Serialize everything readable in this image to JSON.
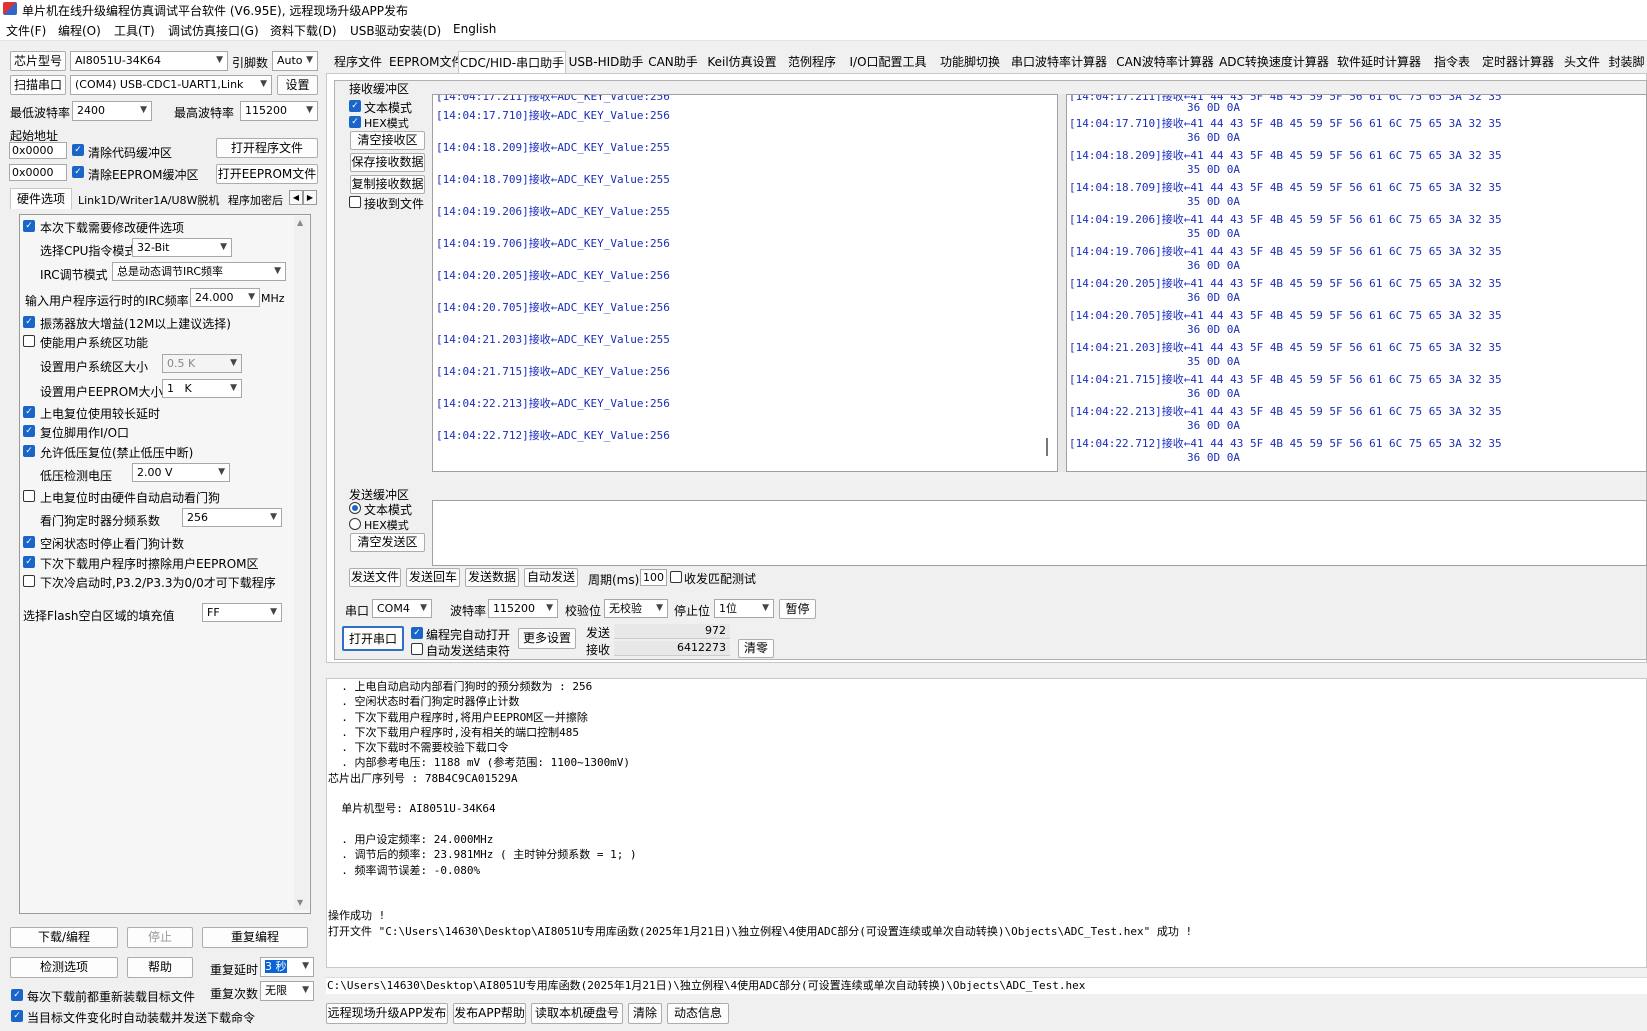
{
  "window": {
    "title": "单片机在线升级编程仿真调试平台软件 (V6.95E), 远程现场升级APP发布"
  },
  "menu": [
    "文件(F)",
    "编程(O)",
    "工具(T)",
    "调试仿真接口(G)",
    "资料下载(D)",
    "USB驱动安装(D)",
    "English"
  ],
  "left": {
    "chip_label": "芯片型号",
    "chip_value": "AI8051U-34K64",
    "pins_label": "引脚数",
    "pins_value": "Auto",
    "scan_label": "扫描串口",
    "port_value": "(COM4) USB-CDC1-UART1,Link",
    "settings_label": "设置",
    "min_baud_label": "最低波特率",
    "min_baud_value": "2400",
    "max_baud_label": "最高波特率",
    "max_baud_value": "115200",
    "start_addr_label": "起始地址",
    "addr1": "0x0000",
    "addr2": "0x0000",
    "clear_code": "清除代码缓冲区",
    "clear_eeprom": "清除EEPROM缓冲区",
    "open_prog": "打开程序文件",
    "open_eeprom": "打开EEPROM文件",
    "subtabs": [
      "硬件选项",
      "Link1D/Writer1A/U8W脱机",
      "程序加密后"
    ],
    "opts": {
      "o1": "本次下载需要修改硬件选项",
      "cpu_label": "选择CPU指令模式",
      "cpu_value": "32-Bit",
      "irc_label": "IRC调节模式",
      "irc_value": "总是动态调节IRC频率",
      "freq_label": "输入用户程序运行时的IRC频率",
      "freq_value": "24.000",
      "freq_unit": "MHz",
      "o2": "振荡器放大增益(12M以上建议选择)",
      "o3": "使能用户系统区功能",
      "sys_label": "设置用户系统区大小",
      "sys_value": "0.5 K",
      "ee_label": "设置用户EEPROM大小",
      "ee_value": "1   K",
      "o4": "上电复位使用较长延时",
      "o5": "复位脚用作I/O口",
      "o6": "允许低压复位(禁止低压中断)",
      "lv_label": "低压检测电压",
      "lv_value": "2.00 V",
      "o7": "上电复位时由硬件自动启动看门狗",
      "wdt_label": "看门狗定时器分频系数",
      "wdt_value": "256",
      "o8": "空闲状态时停止看门狗计数",
      "o9": "下次下载用户程序时擦除用户EEPROM区",
      "o10": "下次冷启动时,P3.2/P3.3为0/0才可下载程序",
      "fill_label": "选择Flash空白区域的填充值",
      "fill_value": "FF"
    },
    "btn_download": "下载/编程",
    "btn_stop": "停止",
    "btn_reprog": "重复编程",
    "btn_check": "检测选项",
    "btn_help": "帮助",
    "delay_label": "重复延时",
    "delay_value": "3 秒",
    "count_label": "重复次数",
    "count_value": "无限",
    "reload": "每次下载前都重新装载目标文件",
    "autoload": "当目标文件变化时自动装载并发送下载命令"
  },
  "tabs": [
    "程序文件",
    "EEPROM文件",
    "CDC/HID-串口助手",
    "USB-HID助手",
    "CAN助手",
    "Keil仿真设置",
    "范例程序",
    "I/O口配置工具",
    "功能脚切换",
    "串口波特率计算器",
    "CAN波特率计算器",
    "ADC转换速度计算器",
    "软件延时计算器",
    "指令表",
    "定时器计算器",
    "头文件",
    "封装脚"
  ],
  "rx": {
    "title": "接收缓冲区",
    "text_mode": "文本模式",
    "hex_mode": "HEX模式",
    "clear": "清空接收区",
    "save": "保存接收数据",
    "copy": "复制接收数据",
    "to_file": "接收到文件",
    "text_lines": [
      {
        "ts": "[14:04:17.710]",
        "arrow": "接收←",
        "msg": "ADC_KEY_Value:256"
      },
      {
        "ts": "[14:04:18.209]",
        "arrow": "接收←",
        "msg": "ADC_KEY_Value:255"
      },
      {
        "ts": "[14:04:18.709]",
        "arrow": "接收←",
        "msg": "ADC_KEY_Value:255"
      },
      {
        "ts": "[14:04:19.206]",
        "arrow": "接收←",
        "msg": "ADC_KEY_Value:255"
      },
      {
        "ts": "[14:04:19.706]",
        "arrow": "接收←",
        "msg": "ADC_KEY_Value:256"
      },
      {
        "ts": "[14:04:20.205]",
        "arrow": "接收←",
        "msg": "ADC_KEY_Value:256"
      },
      {
        "ts": "[14:04:20.705]",
        "arrow": "接收←",
        "msg": "ADC_KEY_Value:256"
      },
      {
        "ts": "[14:04:21.203]",
        "arrow": "接收←",
        "msg": "ADC_KEY_Value:255"
      },
      {
        "ts": "[14:04:21.715]",
        "arrow": "接收←",
        "msg": "ADC_KEY_Value:256"
      },
      {
        "ts": "[14:04:22.213]",
        "arrow": "接收←",
        "msg": "ADC_KEY_Value:256"
      },
      {
        "ts": "[14:04:22.712]",
        "arrow": "接收←",
        "msg": "ADC_KEY_Value:256"
      }
    ],
    "hex_top": "36 0D 0A",
    "hex_lines": [
      {
        "ts": "[14:04:17.710]",
        "arrow": "接收←",
        "hex": "41 44 43 5F 4B 45 59 5F 56 61 6C 75 65 3A 32 35",
        "tail": "36 0D 0A"
      },
      {
        "ts": "[14:04:18.209]",
        "arrow": "接收←",
        "hex": "41 44 43 5F 4B 45 59 5F 56 61 6C 75 65 3A 32 35",
        "tail": "35 0D 0A"
      },
      {
        "ts": "[14:04:18.709]",
        "arrow": "接收←",
        "hex": "41 44 43 5F 4B 45 59 5F 56 61 6C 75 65 3A 32 35",
        "tail": "35 0D 0A"
      },
      {
        "ts": "[14:04:19.206]",
        "arrow": "接收←",
        "hex": "41 44 43 5F 4B 45 59 5F 56 61 6C 75 65 3A 32 35",
        "tail": "35 0D 0A"
      },
      {
        "ts": "[14:04:19.706]",
        "arrow": "接收←",
        "hex": "41 44 43 5F 4B 45 59 5F 56 61 6C 75 65 3A 32 35",
        "tail": "36 0D 0A"
      },
      {
        "ts": "[14:04:20.205]",
        "arrow": "接收←",
        "hex": "41 44 43 5F 4B 45 59 5F 56 61 6C 75 65 3A 32 35",
        "tail": "36 0D 0A"
      },
      {
        "ts": "[14:04:20.705]",
        "arrow": "接收←",
        "hex": "41 44 43 5F 4B 45 59 5F 56 61 6C 75 65 3A 32 35",
        "tail": "36 0D 0A"
      },
      {
        "ts": "[14:04:21.203]",
        "arrow": "接收←",
        "hex": "41 44 43 5F 4B 45 59 5F 56 61 6C 75 65 3A 32 35",
        "tail": "35 0D 0A"
      },
      {
        "ts": "[14:04:21.715]",
        "arrow": "接收←",
        "hex": "41 44 43 5F 4B 45 59 5F 56 61 6C 75 65 3A 32 35",
        "tail": "36 0D 0A"
      },
      {
        "ts": "[14:04:22.213]",
        "arrow": "接收←",
        "hex": "41 44 43 5F 4B 45 59 5F 56 61 6C 75 65 3A 32 35",
        "tail": "36 0D 0A"
      },
      {
        "ts": "[14:04:22.712]",
        "arrow": "接收←",
        "hex": "41 44 43 5F 4B 45 59 5F 56 61 6C 75 65 3A 32 35",
        "tail": "36 0D 0A"
      }
    ]
  },
  "tx": {
    "title": "发送缓冲区",
    "text_mode": "文本模式",
    "hex_mode": "HEX模式",
    "clear": "清空发送区"
  },
  "txbtns": {
    "send_file": "发送文件",
    "send_enter": "发送回车",
    "send_data": "发送数据",
    "auto_send": "自动发送",
    "period_label": "周期(ms)",
    "period_value": "100",
    "match_test": "收发匹配测试"
  },
  "serial": {
    "port_label": "串口",
    "port_value": "COM4",
    "baud_label": "波特率",
    "baud_value": "115200",
    "parity_label": "校验位",
    "parity_value": "无校验",
    "stop_label": "停止位",
    "stop_value": "1位",
    "pause": "暂停",
    "open_port": "打开串口",
    "auto_open": "编程完自动打开",
    "auto_end": "自动发送结束符",
    "more": "更多设置",
    "send_label": "发送",
    "send_count": "972",
    "recv_label": "接收",
    "recv_count": "6412273",
    "zero": "清零"
  },
  "log": [
    "  . 上电自动启动内部看门狗时的预分频数为 : 256",
    "  . 空闲状态时看门狗定时器停止计数",
    "  . 下次下载用户程序时,将用户EEPROM区一并擦除",
    "  . 下次下载用户程序时,没有相关的端口控制485",
    "  . 下次下载时不需要校验下载口令",
    "  . 内部参考电压: 1188 mV (参考范围: 1100~1300mV)",
    "芯片出厂序列号 : 78B4C9CA01529A",
    "",
    "  单片机型号: AI8051U-34K64",
    "",
    "  . 用户设定频率: 24.000MHz",
    "  . 调节后的频率: 23.981MHz ( 主时钟分频系数 = 1; )",
    "  . 频率调节误差: -0.080%",
    "",
    "",
    "操作成功 !",
    "打开文件 \"C:\\Users\\14630\\Desktop\\AI8051U专用库函数(2025年1月21日)\\独立例程\\4使用ADC部分(可设置连续或单次自动转换)\\Objects\\ADC_Test.hex\" 成功 !"
  ],
  "path": "C:\\Users\\14630\\Desktop\\AI8051U专用库函数(2025年1月21日)\\独立例程\\4使用ADC部分(可设置连续或单次自动转换)\\Objects\\ADC_Test.hex",
  "bottom": [
    "远程现场升级APP发布",
    "发布APP帮助",
    "读取本机硬盘号",
    "清除",
    "动态信息"
  ]
}
